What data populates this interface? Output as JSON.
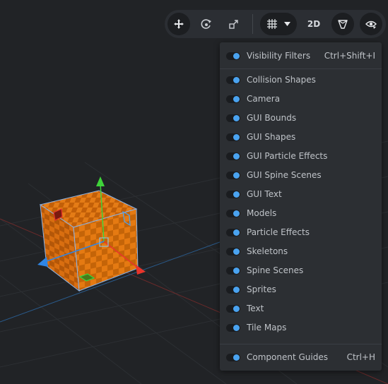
{
  "toolbar": {
    "move_tool": "move-tool-icon",
    "rotate_tool": "rotate-tool-icon",
    "scale_tool": "scale-tool-icon",
    "grid_toggle": "grid-icon",
    "view_2d_label": "2D",
    "perspective_toggle": "camera-frustum-icon",
    "visibility_toggle": "eye-icon"
  },
  "menu": {
    "header": {
      "label": "Visibility Filters",
      "shortcut": "Ctrl+Shift+I",
      "on": true
    },
    "items": [
      {
        "label": "Collision Shapes",
        "on": true
      },
      {
        "label": "Camera",
        "on": true
      },
      {
        "label": "GUI Bounds",
        "on": true
      },
      {
        "label": "GUI Shapes",
        "on": true
      },
      {
        "label": "GUI Particle Effects",
        "on": true
      },
      {
        "label": "GUI Spine Scenes",
        "on": true
      },
      {
        "label": "GUI Text",
        "on": true
      },
      {
        "label": "Models",
        "on": true
      },
      {
        "label": "Particle Effects",
        "on": true
      },
      {
        "label": "Skeletons",
        "on": true
      },
      {
        "label": "Spine Scenes",
        "on": true
      },
      {
        "label": "Sprites",
        "on": true
      },
      {
        "label": "Text",
        "on": true
      },
      {
        "label": "Tile Maps",
        "on": true
      }
    ],
    "footer": {
      "label": "Component Guides",
      "shortcut": "Ctrl+H",
      "on": true
    }
  },
  "colors": {
    "background": "#212326",
    "accent": "#4aa3f0",
    "cube": "#e0730f",
    "axis_x": "#e8352b",
    "axis_y": "#3fd33a",
    "axis_z": "#2f86e6"
  }
}
